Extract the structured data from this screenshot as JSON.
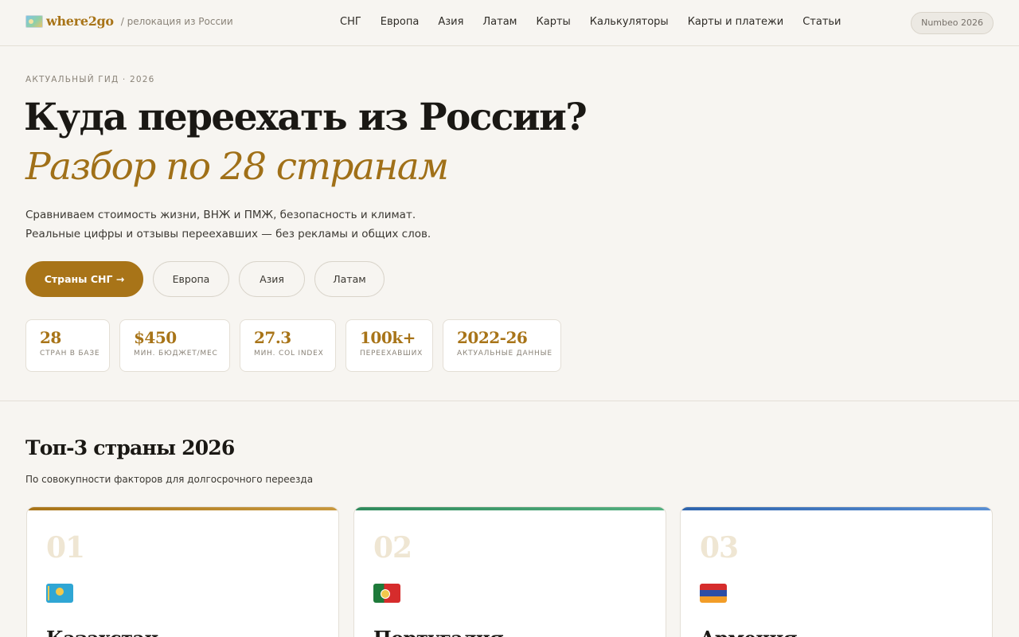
{
  "header": {
    "logo_text": "where2go",
    "tagline": "/ релокация из России",
    "nav": [
      "СНГ",
      "Европа",
      "Азия",
      "Латам",
      "Карты",
      "Калькуляторы",
      "Карты и платежи",
      "Статьи"
    ],
    "badge": "Numbeo 2026"
  },
  "hero": {
    "eyebrow": "АКТУАЛЬНЫЙ ГИД · 2026",
    "title": "Куда переехать из России?",
    "title_accent": "Разбор по 28 странам",
    "lead": "Сравниваем стоимость жизни, ВНЖ и ПМЖ, безопасность и климат. Реальные цифры и отзывы переехавших — без рекламы и общих слов.",
    "buttons": {
      "primary": "Страны СНГ →",
      "europe": "Европа",
      "asia": "Азия",
      "latam": "Латам"
    },
    "stats": [
      {
        "value": "28",
        "label": "СТРАН В БАЗЕ"
      },
      {
        "value": "$450",
        "label": "МИН. БЮДЖЕТ/МЕС"
      },
      {
        "value": "27.3",
        "label": "МИН. COL INDEX"
      },
      {
        "value": "100k+",
        "label": "ПЕРЕЕХАВШИХ"
      },
      {
        "value": "2022-26",
        "label": "АКТУАЛЬНЫЕ ДАННЫЕ"
      }
    ]
  },
  "top3": {
    "title": "Топ-3 страны 2026",
    "subtitle": "По совокупности факторов для долгосрочного переезда",
    "cards": [
      {
        "num": "01",
        "country": "Казахстан",
        "flag": "kazakhstan-flag-icon",
        "accent": "#a87418"
      },
      {
        "num": "02",
        "country": "Португалия",
        "flag": "portugal-flag-icon",
        "accent": "#2f8a5c"
      },
      {
        "num": "03",
        "country": "Армения",
        "flag": "armenia-flag-icon",
        "accent": "#2e64ad"
      }
    ]
  }
}
